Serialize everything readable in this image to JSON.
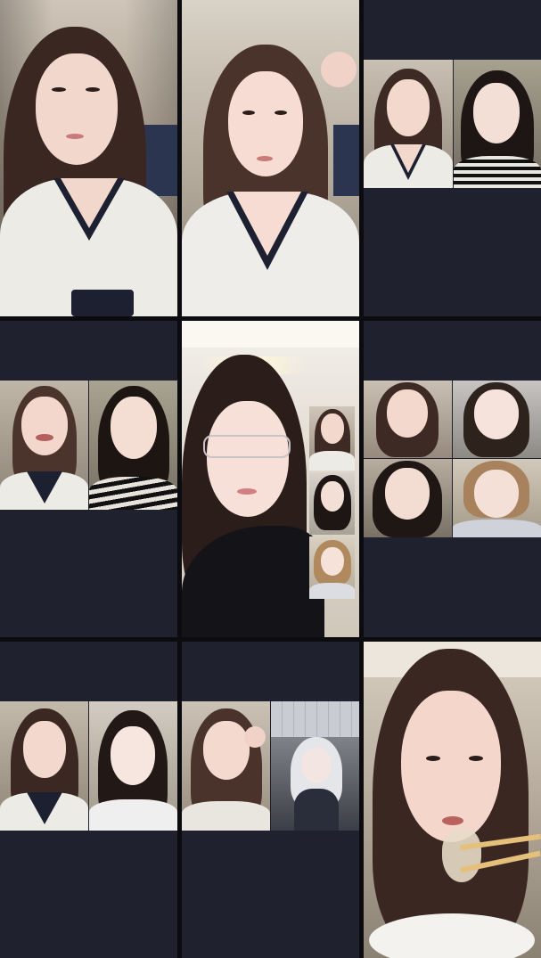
{
  "screen": {
    "type": "multi-stream video grid",
    "layout": "3x3"
  },
  "cells": [
    {
      "id": 1,
      "content": "single-host-video",
      "tiles": 1
    },
    {
      "id": 2,
      "content": "single-host-video",
      "tiles": 1
    },
    {
      "id": 3,
      "content": "two-person-co-stream",
      "tiles": 2
    },
    {
      "id": 4,
      "content": "two-person-co-stream",
      "tiles": 2
    },
    {
      "id": 5,
      "content": "host-with-guest-strip",
      "tiles": 4
    },
    {
      "id": 6,
      "content": "four-person-co-stream",
      "tiles": 4
    },
    {
      "id": 7,
      "content": "two-person-co-stream",
      "tiles": 2
    },
    {
      "id": 8,
      "content": "two-person-co-stream-with-avatar",
      "tiles": 2
    },
    {
      "id": 9,
      "content": "single-host-video-eating",
      "tiles": 1
    }
  ],
  "colors": {
    "divider": "#0b0b10",
    "empty_panel": "#20212e"
  }
}
